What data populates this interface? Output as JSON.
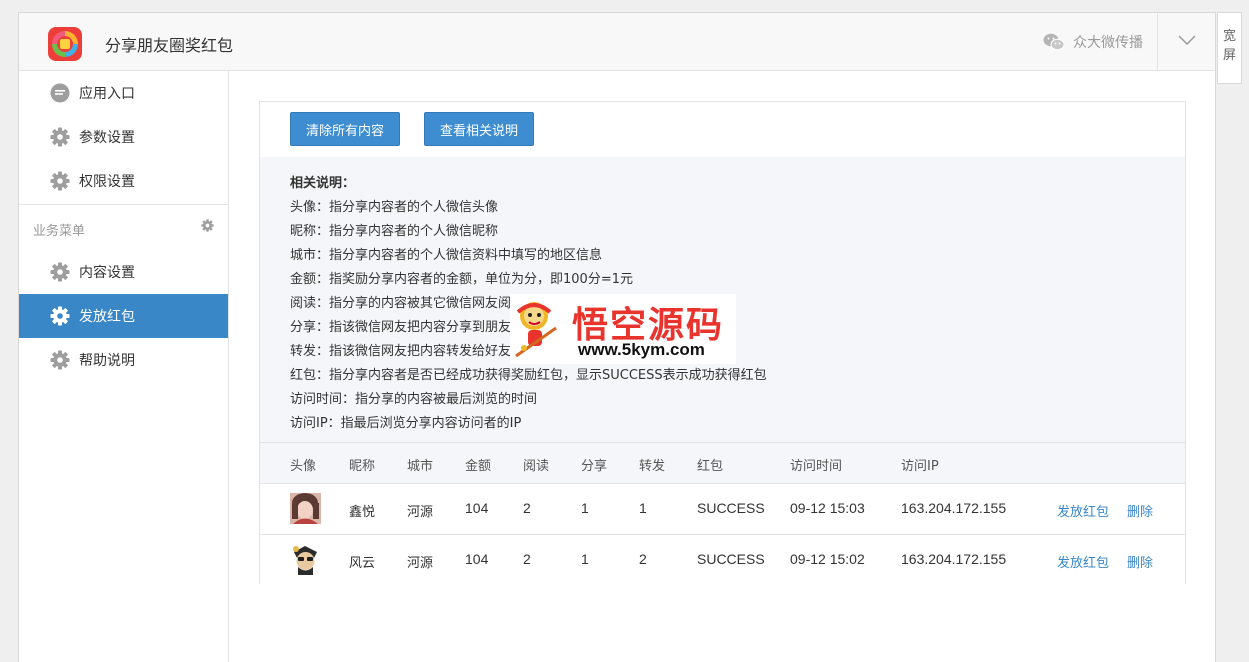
{
  "header": {
    "title": "分享朋友圈奖红包",
    "brand": "众大微传播",
    "wide_button": "宽屏"
  },
  "sidebar": {
    "items_top": [
      {
        "label": "应用入口",
        "icon": "message-icon"
      },
      {
        "label": "参数设置",
        "icon": "gear-icon"
      },
      {
        "label": "权限设置",
        "icon": "gear-icon"
      }
    ],
    "group_title": "业务菜单",
    "items_bottom": [
      {
        "label": "内容设置",
        "icon": "gear-icon",
        "active": false
      },
      {
        "label": "发放红包",
        "icon": "gear-icon",
        "active": true
      },
      {
        "label": "帮助说明",
        "icon": "gear-icon",
        "active": false
      }
    ]
  },
  "toolbar": {
    "clear_label": "清除所有内容",
    "help_label": "查看相关说明"
  },
  "notes": {
    "title": "相关说明：",
    "lines": [
      "头像：指分享内容者的个人微信头像",
      "昵称：指分享内容者的个人微信昵称",
      "城市：指分享内容者的个人微信资料中填写的地区信息",
      "金额：指奖励分享内容者的金额，单位为分，即100分=1元",
      "阅读：指分享的内容被其它微信网友阅读浏览的次数",
      "分享：指该微信网友把内容分享到朋友圈的次数",
      "转发：指该微信网友把内容转发给好友的次数",
      "红包：指分享内容者是否已经成功获得奖励红包，显示SUCCESS表示成功获得红包",
      "访问时间：指分享的内容被最后浏览的时间",
      "访问IP：指最后浏览分享内容访问者的IP"
    ]
  },
  "watermark": {
    "cn": "悟空源码",
    "url": "www.5kym.com"
  },
  "table": {
    "headers": [
      "头像",
      "昵称",
      "城市",
      "金额",
      "阅读",
      "分享",
      "转发",
      "红包",
      "访问时间",
      "访问IP"
    ],
    "rows": [
      {
        "nickname": "鑫悦",
        "city": "河源",
        "amount": "104",
        "reads": "2",
        "shares": "1",
        "forwards": "1",
        "redpack": "SUCCESS",
        "time": "09-12 15:03",
        "ip": "163.204.172.155",
        "send": "发放红包",
        "delete": "删除"
      },
      {
        "nickname": "风云",
        "city": "河源",
        "amount": "104",
        "reads": "2",
        "shares": "1",
        "forwards": "2",
        "redpack": "SUCCESS",
        "time": "09-12 15:02",
        "ip": "163.204.172.155",
        "send": "发放红包",
        "delete": "删除"
      }
    ]
  },
  "colors": {
    "accent": "#3a87c8",
    "button": "#3e8dd0",
    "watermark_red": "#e8342d"
  }
}
